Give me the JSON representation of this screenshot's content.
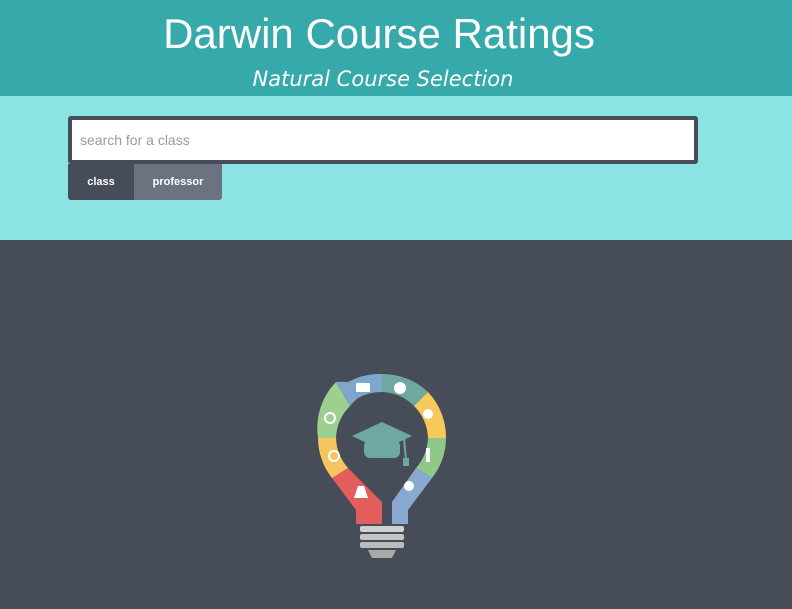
{
  "header": {
    "title": "Darwin Course Ratings",
    "subtitle": "Natural Course Selection"
  },
  "search": {
    "placeholder": "search for a class",
    "value": "",
    "modes": [
      {
        "label": "class",
        "active": true
      },
      {
        "label": "professor",
        "active": false
      }
    ]
  },
  "colors": {
    "header_bg": "#36a9aa",
    "search_band_bg": "#8be3e3",
    "page_bg": "#474d58",
    "active_tab": "#474d58",
    "inactive_tab": "#6b7380"
  },
  "illustration": {
    "icon": "lightbulb-education-icon",
    "segment_icons": [
      "book-icon",
      "palette-icon",
      "lightbulb-icon",
      "pencil-icon",
      "globe-icon",
      "flask-icon",
      "atom-icon",
      "magnifier-icon",
      "graduation-cap-icon"
    ]
  }
}
